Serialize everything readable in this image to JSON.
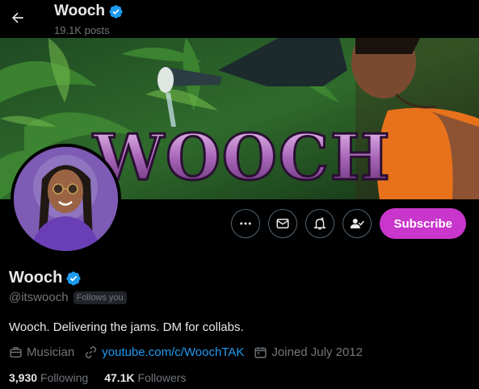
{
  "header": {
    "name": "Wooch",
    "post_count": "19.1K posts"
  },
  "banner": {
    "title_text": "WOOCH"
  },
  "actions": {
    "subscribe_label": "Subscribe"
  },
  "profile": {
    "display_name": "Wooch",
    "handle": "@itswooch",
    "follows_you": "Follows you",
    "bio": "Wooch. Delivering the jams. DM for collabs.",
    "category": "Musician",
    "website": "youtube.com/c/WoochTAK",
    "joined": "Joined July 2012"
  },
  "stats": {
    "following_count": "3,930",
    "following_label": "Following",
    "followers_count": "47.1K",
    "followers_label": "Followers"
  },
  "colors": {
    "accent": "#1d9bf0",
    "subscribe": "#c936cc",
    "muted": "#71767b",
    "text": "#e7e9ea"
  }
}
